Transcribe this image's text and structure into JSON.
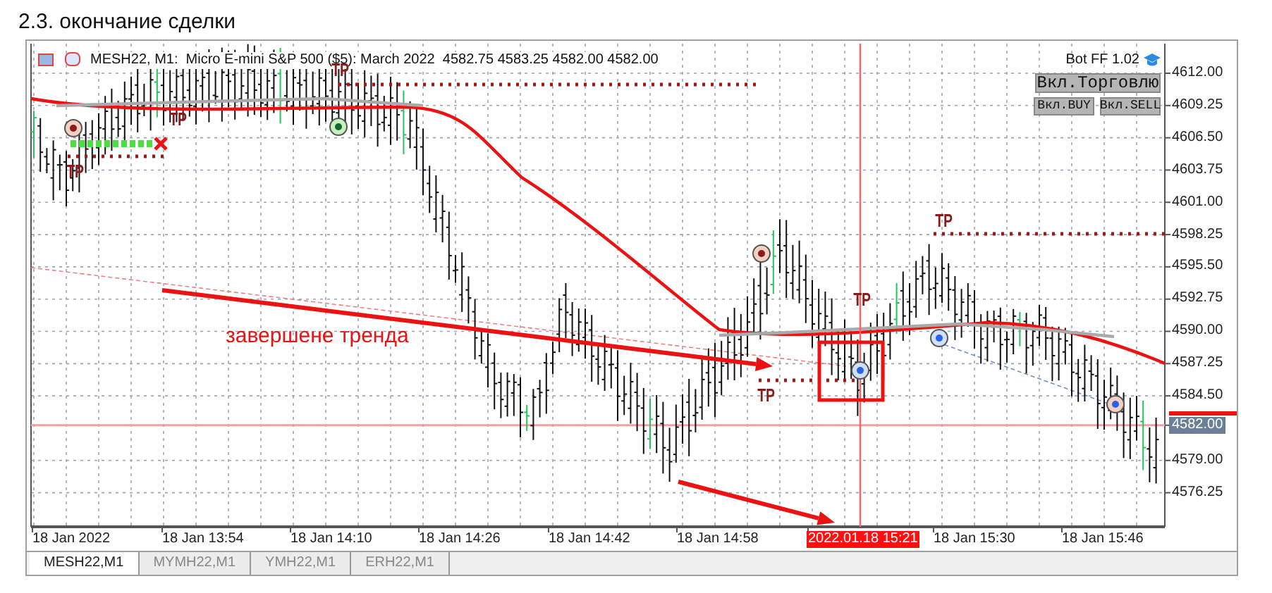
{
  "heading": "2.3. окончание сделки",
  "chart": {
    "symbol_line": "MESH22, M1:  Micro E-mini S&P 500 ($5): March 2022  4582.75 4583.25 4582.00 4582.00",
    "bot_label": "Bot FF 1.02",
    "buttons": [
      {
        "label": "Вкл.Торговлю",
        "kind": "large"
      },
      {
        "label": "Вкл.BUY",
        "kind": "small"
      },
      {
        "label": "Вкл.SELL",
        "kind": "small"
      }
    ],
    "price_ticks": [
      "4612.00",
      "4609.25",
      "4606.50",
      "4603.75",
      "4601.00",
      "4598.25",
      "4595.50",
      "4592.75",
      "4590.00",
      "4587.25",
      "4584.50",
      "4579.00",
      "4576.25"
    ],
    "current_price": "4582.00",
    "time_ticks": [
      {
        "label": "18 Jan 2022",
        "highlighted": false
      },
      {
        "label": "18 Jan 13:54",
        "highlighted": false
      },
      {
        "label": "18 Jan 14:10",
        "highlighted": false
      },
      {
        "label": "18 Jan 14:26",
        "highlighted": false
      },
      {
        "label": "18 Jan 14:42",
        "highlighted": false
      },
      {
        "label": "18 Jan 14:58",
        "highlighted": false
      },
      {
        "label": "2022.01.18 15:21",
        "highlighted": true
      },
      {
        "label": "18 Jan 15:30",
        "highlighted": false
      },
      {
        "label": "18 Jan 15:46",
        "highlighted": false
      }
    ],
    "markers": [
      "TP",
      "TP",
      "TP",
      "TP",
      "TP",
      "TP"
    ],
    "annotation": "завершене тренда"
  },
  "tabs": [
    {
      "label": "MESH22,M1",
      "selected": true
    },
    {
      "label": "MYMH22,M1",
      "selected": false
    },
    {
      "label": "YMH22,M1",
      "selected": false
    },
    {
      "label": "ERH22,M1",
      "selected": false
    }
  ]
}
